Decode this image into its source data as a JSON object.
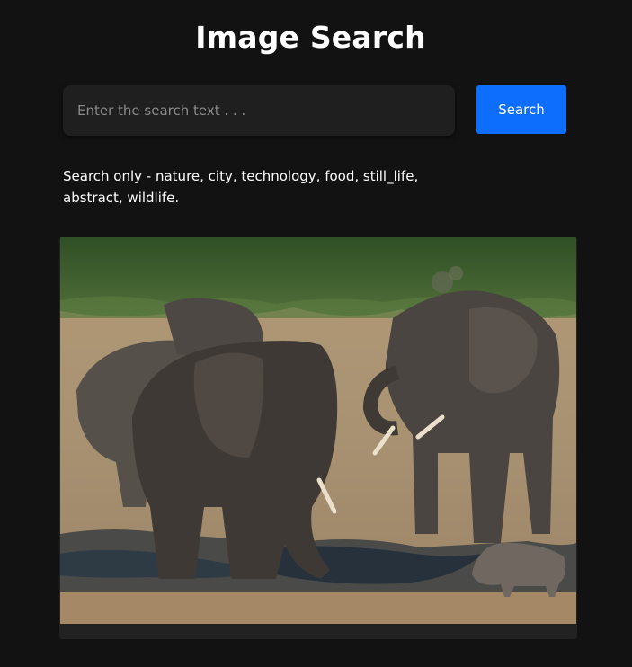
{
  "header": {
    "title": "Image Search"
  },
  "search": {
    "placeholder": "Enter the search text . . .",
    "value": "",
    "button_label": "Search"
  },
  "hint": {
    "text": "Search only - nature, city, technology, food, still_life, abstract, wildlife."
  },
  "results": [
    {
      "subject": "elephants-and-warthog-at-waterhole"
    }
  ],
  "colors": {
    "background": "#121212",
    "input": "#1f1f1f",
    "accent": "#0d6efd",
    "card": "#222222"
  }
}
